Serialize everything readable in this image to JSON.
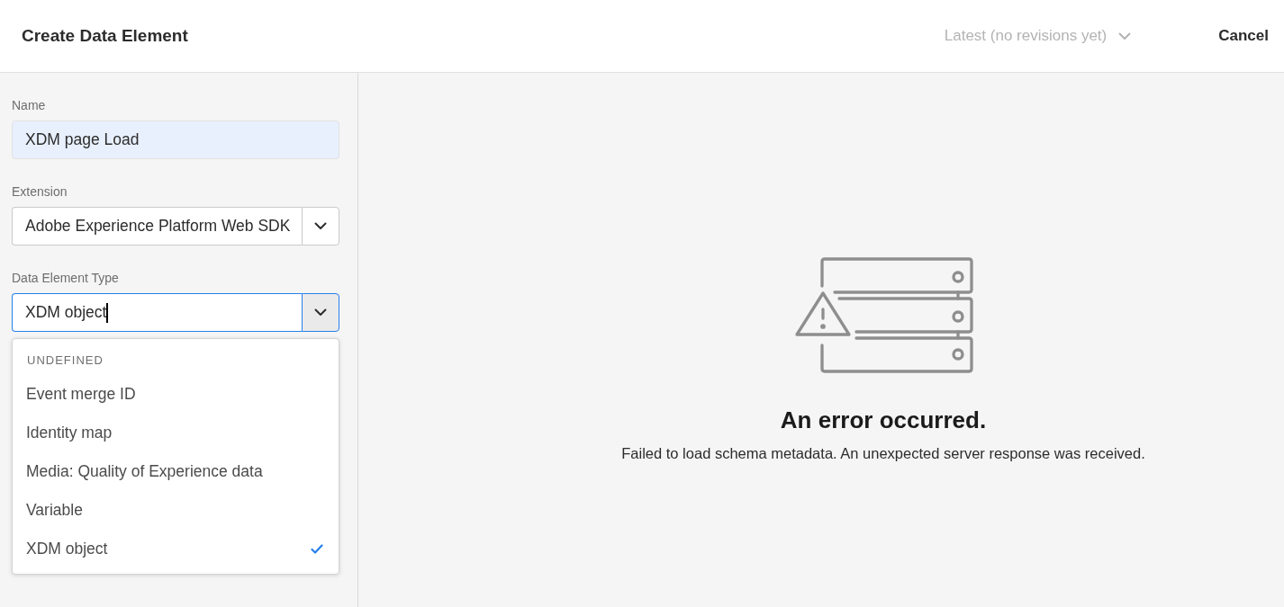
{
  "header": {
    "title": "Create Data Element",
    "revision_picker": {
      "value": "Latest (no revisions yet)",
      "disabled": true
    },
    "cancel_button": {
      "label": "Cancel"
    }
  },
  "form": {
    "fields": [
      {
        "kind": "text",
        "label": "Name",
        "value": "XDM page Load",
        "autofilled": true,
        "focused": false
      },
      {
        "kind": "picker",
        "label": "Extension",
        "value": "Adobe Experience Platform Web SDK",
        "focused": false
      },
      {
        "kind": "combobox",
        "label": "Data Element Type",
        "value": "XDM object",
        "focused": true,
        "expanded": true,
        "option_groups": [
          {
            "heading": "UNDEFINED",
            "options": [
              {
                "label": "Event merge ID",
                "selected": false
              },
              {
                "label": "Identity map",
                "selected": false
              },
              {
                "label": "Media: Quality of Experience data",
                "selected": false
              },
              {
                "label": "Variable",
                "selected": false
              },
              {
                "label": "XDM object",
                "selected": true
              }
            ]
          }
        ]
      }
    ]
  },
  "error_panel": {
    "title": "An error occurred.",
    "message": "Failed to load schema metadata. An unexpected server response was received."
  }
}
